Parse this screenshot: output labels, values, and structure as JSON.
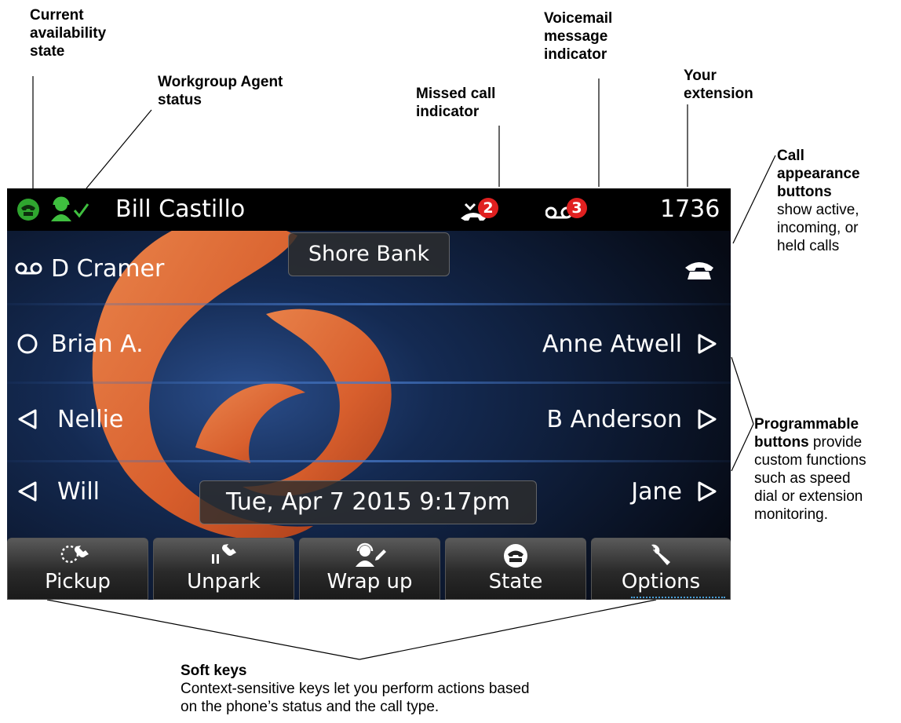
{
  "annotations": {
    "availability": [
      "Current",
      "availability",
      "state"
    ],
    "agent": [
      "Workgroup Agent",
      "status"
    ],
    "missed": [
      "Missed call",
      "indicator"
    ],
    "voicemail": [
      "Voicemail",
      "message",
      "indicator"
    ],
    "extension": [
      "Your",
      "extension"
    ],
    "call_appearance": {
      "bold": [
        "Call",
        "appearance",
        "buttons"
      ],
      "text": [
        "show active,",
        "incoming, or",
        "held calls"
      ]
    },
    "programmable": {
      "line1_bold": "Programmable",
      "line2_bold": "buttons",
      "line2_rest": " provide",
      "text": [
        "custom functions",
        "such as speed",
        "dial or extension",
        "monitoring."
      ]
    },
    "softkeys": {
      "title": "Soft keys",
      "text": [
        "Context-sensitive keys let you perform actions based",
        "on the phone’s status and the call type."
      ]
    }
  },
  "phone": {
    "status": {
      "user_name": "Bill Castillo",
      "missed_count": "2",
      "voicemail_count": "3",
      "extension": "1736"
    },
    "overlay_top": "Shore Bank",
    "overlay_date": "Tue, Apr 7 2015 9:17pm",
    "left_buttons": [
      "D Cramer",
      "Brian A.",
      "Nellie",
      "Will"
    ],
    "right_buttons": [
      "Anne Atwell",
      "B Anderson",
      "Jane"
    ],
    "softkeys": [
      "Pickup",
      "Unpark",
      "Wrap up",
      "State",
      "Options"
    ]
  },
  "colors": {
    "status_green": "#2fa52f",
    "badge_red": "#e02020",
    "swirl_orange": "#e8652a"
  }
}
